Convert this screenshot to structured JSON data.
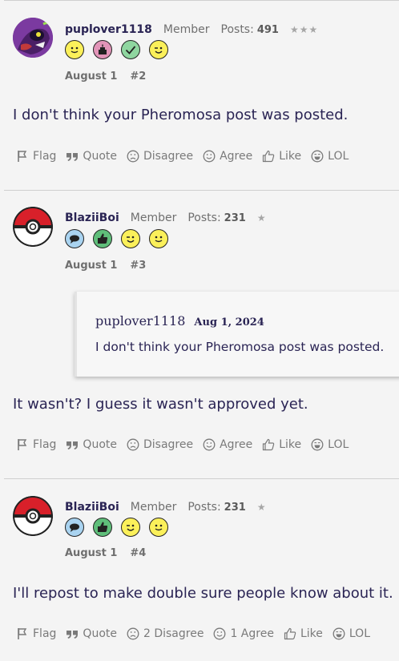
{
  "posts": [
    {
      "username": "puplover1118",
      "role": "Member",
      "posts_label": "Posts:",
      "posts_count": "491",
      "stars": "★★★",
      "badges": [
        "smile-badge-icon",
        "cake-badge-icon",
        "checkmark-badge-icon",
        "wink-badge-icon"
      ],
      "date": "August 1",
      "post_number": "#2",
      "body": "I don't think your Pheromosa post was posted.",
      "actions": {
        "flag": "Flag",
        "quote": "Quote",
        "disagree": "Disagree",
        "agree": "Agree",
        "like": "Like",
        "lol": "LOL"
      }
    },
    {
      "username": "BlaziiBoi",
      "role": "Member",
      "posts_label": "Posts:",
      "posts_count": "231",
      "stars": "★",
      "badges": [
        "speech-bubble-badge-icon",
        "thumbs-up-badge-icon",
        "wink-badge-icon",
        "smile-badge-icon"
      ],
      "date": "August 1",
      "post_number": "#3",
      "quote": {
        "author": "puplover1118",
        "date": "Aug 1, 2024",
        "text": "I don't think your Pheromosa post was posted."
      },
      "body": "It wasn't? I guess it wasn't approved yet.",
      "actions": {
        "flag": "Flag",
        "quote": "Quote",
        "disagree": "Disagree",
        "agree": "Agree",
        "like": "Like",
        "lol": "LOL"
      }
    },
    {
      "username": "BlaziiBoi",
      "role": "Member",
      "posts_label": "Posts:",
      "posts_count": "231",
      "stars": "★",
      "badges": [
        "speech-bubble-badge-icon",
        "thumbs-up-badge-icon",
        "wink-badge-icon",
        "smile-badge-icon"
      ],
      "date": "August 1",
      "post_number": "#4",
      "body": "I'll repost to make double sure people know about it.",
      "actions": {
        "flag": "Flag",
        "quote": "Quote",
        "disagree": "2 Disagree",
        "agree": "1 Agree",
        "like": "Like",
        "lol": "LOL"
      }
    }
  ],
  "colors": {
    "text": "#2a2454",
    "muted": "#6f6f6f",
    "background": "#f4f4f4",
    "pokeball_red": "#d8202a"
  }
}
